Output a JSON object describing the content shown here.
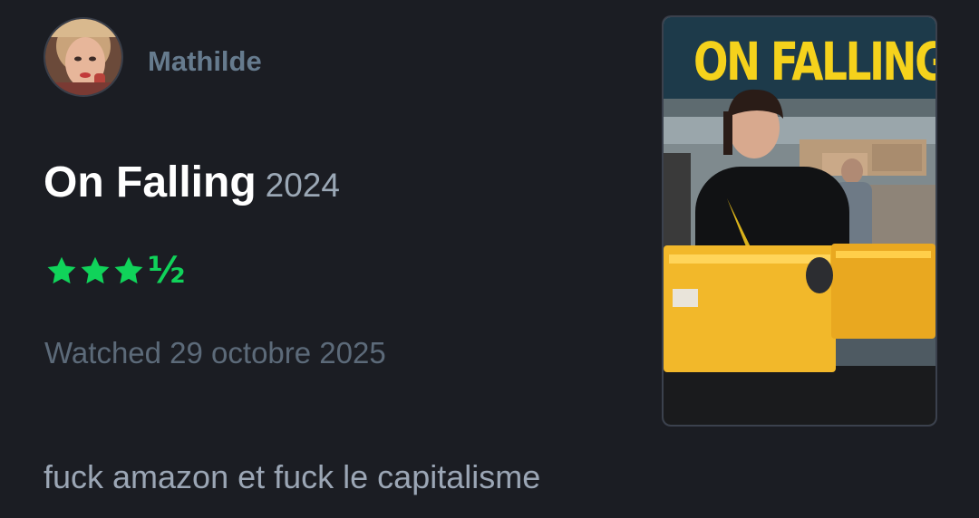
{
  "author": {
    "name": "Mathilde"
  },
  "film": {
    "title": "On Falling",
    "year": "2024",
    "poster_title": "ON FALLING"
  },
  "rating": {
    "stars": 3.5,
    "max": 5,
    "half_glyph": "½",
    "color": "#10d35a"
  },
  "watched": {
    "text": "Watched 29 octobre 2025"
  },
  "review": {
    "text": "fuck amazon et fuck le capitalisme"
  },
  "colors": {
    "background": "#1b1d23",
    "author": "#667b8e",
    "title": "#ffffff",
    "year": "#9ba8b6",
    "muted": "#5c6a79",
    "body": "#9ba6b5",
    "poster_title": "#f5d21c"
  }
}
